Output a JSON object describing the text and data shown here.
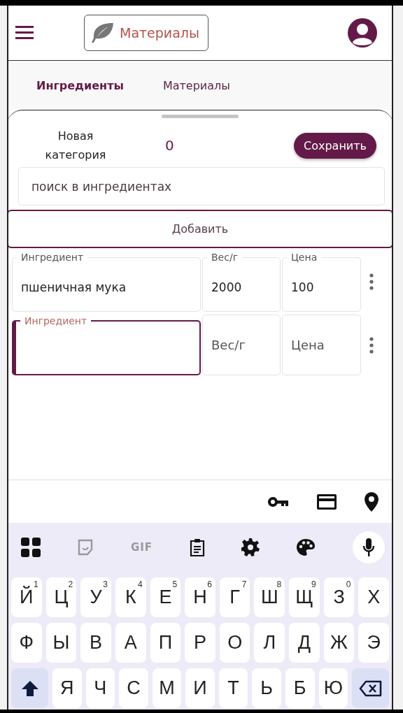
{
  "header": {
    "title": "Материалы"
  },
  "tabs": [
    {
      "label": "Ингредиенты",
      "selected": true
    },
    {
      "label": "Материалы",
      "selected": false
    }
  ],
  "sheet": {
    "category_label": "Новая категория",
    "count": "0",
    "save_button": "Сохранить",
    "search": {
      "placeholder": "поиск в ингредиентах"
    },
    "add_button": "Добавить"
  },
  "rows": [
    {
      "fields": [
        {
          "label": "Ингредиент",
          "value": "пшеничная мука",
          "focused": false
        },
        {
          "label": "Вес/г",
          "value": "2000",
          "focused": false
        },
        {
          "label": "Цена",
          "value": "100",
          "focused": false
        }
      ]
    },
    {
      "fields": [
        {
          "label": "Ингредиент",
          "focused": true
        },
        {
          "placeholder": "Вес/г",
          "focused": false
        },
        {
          "placeholder": "Цена",
          "focused": false
        }
      ]
    }
  ],
  "keyboard": {
    "toolbar_text": "GIF",
    "rows": [
      [
        {
          "kind": "letter",
          "char": "Й",
          "hint": "1"
        },
        {
          "kind": "letter",
          "char": "Ц",
          "hint": "2"
        },
        {
          "kind": "letter",
          "char": "У",
          "hint": "3"
        },
        {
          "kind": "letter",
          "char": "К",
          "hint": "4"
        },
        {
          "kind": "letter",
          "char": "Е",
          "hint": "5"
        },
        {
          "kind": "letter",
          "char": "Н",
          "hint": "6"
        },
        {
          "kind": "letter",
          "char": "Г",
          "hint": "7"
        },
        {
          "kind": "letter",
          "char": "Ш",
          "hint": "8"
        },
        {
          "kind": "letter",
          "char": "Щ",
          "hint": "9"
        },
        {
          "kind": "letter",
          "char": "З",
          "hint": "0"
        },
        {
          "kind": "letter",
          "char": "Х"
        }
      ],
      [
        {
          "kind": "letter",
          "char": "Ф"
        },
        {
          "kind": "letter",
          "char": "Ы"
        },
        {
          "kind": "letter",
          "char": "В"
        },
        {
          "kind": "letter",
          "char": "А"
        },
        {
          "kind": "letter",
          "char": "П"
        },
        {
          "kind": "letter",
          "char": "Р"
        },
        {
          "kind": "letter",
          "char": "О"
        },
        {
          "kind": "letter",
          "char": "Л"
        },
        {
          "kind": "letter",
          "char": "Д"
        },
        {
          "kind": "letter",
          "char": "Ж"
        },
        {
          "kind": "letter",
          "char": "Э"
        }
      ],
      [
        {
          "kind": "shift"
        },
        {
          "kind": "letter",
          "char": "Я"
        },
        {
          "kind": "letter",
          "char": "Ч"
        },
        {
          "kind": "letter",
          "char": "С"
        },
        {
          "kind": "letter",
          "char": "М"
        },
        {
          "kind": "letter",
          "char": "И"
        },
        {
          "kind": "letter",
          "char": "Т"
        },
        {
          "kind": "letter",
          "char": "Ь"
        },
        {
          "kind": "letter",
          "char": "Б"
        },
        {
          "kind": "letter",
          "char": "Ю"
        },
        {
          "kind": "backspace"
        }
      ]
    ]
  }
}
